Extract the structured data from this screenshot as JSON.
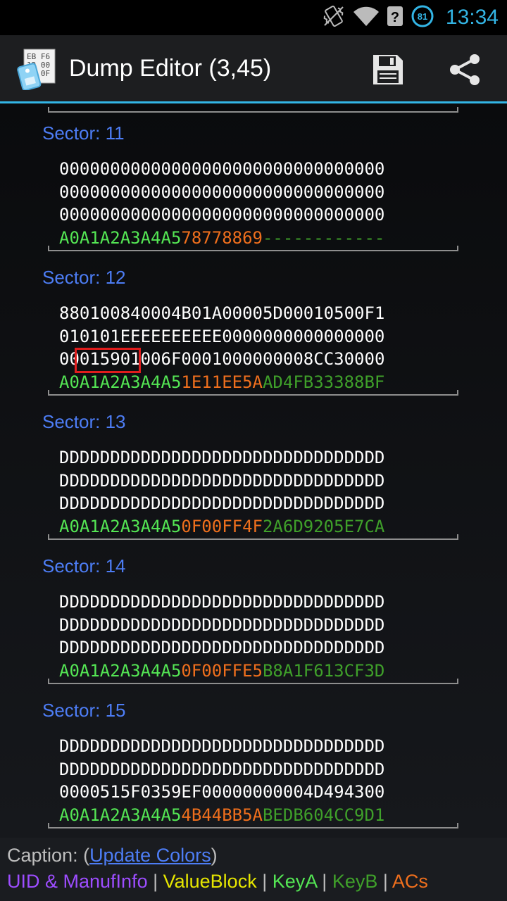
{
  "status_bar": {
    "time": "13:34",
    "battery": "81",
    "icons": [
      "vibrate-icon",
      "wifi-icon",
      "no-signal-icon",
      "battery-icon"
    ]
  },
  "action_bar": {
    "title": "Dump Editor (3,45)",
    "actions": [
      "save-icon",
      "share-icon"
    ]
  },
  "sectors": [
    {
      "title": "Sector: 11",
      "lines": [
        [
          {
            "t": "00000000000000000000000000000000",
            "c": "w"
          }
        ],
        [
          {
            "t": "00000000000000000000000000000000",
            "c": "w"
          }
        ],
        [
          {
            "t": "00000000000000000000000000000000",
            "c": "w"
          }
        ],
        [
          {
            "t": "A0A1A2A3A4A5",
            "c": "ka"
          },
          {
            "t": "78778869",
            "c": "ac"
          },
          {
            "t": "------------",
            "c": "kb"
          }
        ]
      ]
    },
    {
      "title": "Sector: 12",
      "lines": [
        [
          {
            "t": "880100840004B01A00005D00010500F1",
            "c": "w"
          }
        ],
        [
          {
            "t": "010101EEEEEEEEEE0000000000000000",
            "c": "w"
          }
        ],
        [
          {
            "t": "0001590",
            "c": "w"
          },
          {
            "t": "1006F0001000000008CC30000",
            "c": "w"
          }
        ],
        [
          {
            "t": "A0A1A2A3A4A5",
            "c": "ka"
          },
          {
            "t": "1E11EE5A",
            "c": "ac"
          },
          {
            "t": "AD4FB33388BF",
            "c": "kb"
          }
        ]
      ]
    },
    {
      "title": "Sector: 13",
      "lines": [
        [
          {
            "t": "DDDDDDDDDDDDDDDDDDDDDDDDDDDDDDDD",
            "c": "w"
          }
        ],
        [
          {
            "t": "DDDDDDDDDDDDDDDDDDDDDDDDDDDDDDDD",
            "c": "w"
          }
        ],
        [
          {
            "t": "DDDDDDDDDDDDDDDDDDDDDDDDDDDDDDDD",
            "c": "w"
          }
        ],
        [
          {
            "t": "A0A1A2A3A4A5",
            "c": "ka"
          },
          {
            "t": "0F00FF4F",
            "c": "ac"
          },
          {
            "t": "2A6D9205E7CA",
            "c": "kb"
          }
        ]
      ]
    },
    {
      "title": "Sector: 14",
      "lines": [
        [
          {
            "t": "DDDDDDDDDDDDDDDDDDDDDDDDDDDDDDDD",
            "c": "w"
          }
        ],
        [
          {
            "t": "DDDDDDDDDDDDDDDDDDDDDDDDDDDDDDDD",
            "c": "w"
          }
        ],
        [
          {
            "t": "DDDDDDDDDDDDDDDDDDDDDDDDDDDDDDDD",
            "c": "w"
          }
        ],
        [
          {
            "t": "A0A1A2A3A4A5",
            "c": "ka"
          },
          {
            "t": "0F00FFE5",
            "c": "ac"
          },
          {
            "t": "B8A1F613CF3D",
            "c": "kb"
          }
        ]
      ]
    },
    {
      "title": "Sector: 15",
      "lines": [
        [
          {
            "t": "DDDDDDDDDDDDDDDDDDDDDDDDDDDDDDDD",
            "c": "w"
          }
        ],
        [
          {
            "t": "DDDDDDDDDDDDDDDDDDDDDDDDDDDDDDDD",
            "c": "w"
          }
        ],
        [
          {
            "t": "0000515F0359EF00000000004D494300",
            "c": "w"
          }
        ],
        [
          {
            "t": "A0A1A2A3A4A5",
            "c": "ka"
          },
          {
            "t": "4B44BB5A",
            "c": "ac"
          },
          {
            "t": "BEDB604CC9D1",
            "c": "kb"
          }
        ]
      ]
    }
  ],
  "caption": {
    "prefix": "Caption: (",
    "link": "Update Colors",
    "suffix": ")",
    "legend": [
      {
        "label": "UID & ManufInfo",
        "color": "#9d4dff"
      },
      {
        "label": "ValueBlock",
        "color": "#e6e600"
      },
      {
        "label": "KeyA",
        "color": "#54e654"
      },
      {
        "label": "KeyB",
        "color": "#3fa02a"
      },
      {
        "label": "ACs",
        "color": "#ef6f1d"
      }
    ],
    "separator": " | "
  },
  "colors": {
    "accent": "#33b5e5",
    "sector_title": "#4d7df5",
    "text": "#ffffff",
    "cursor": "#e01c1c"
  }
}
